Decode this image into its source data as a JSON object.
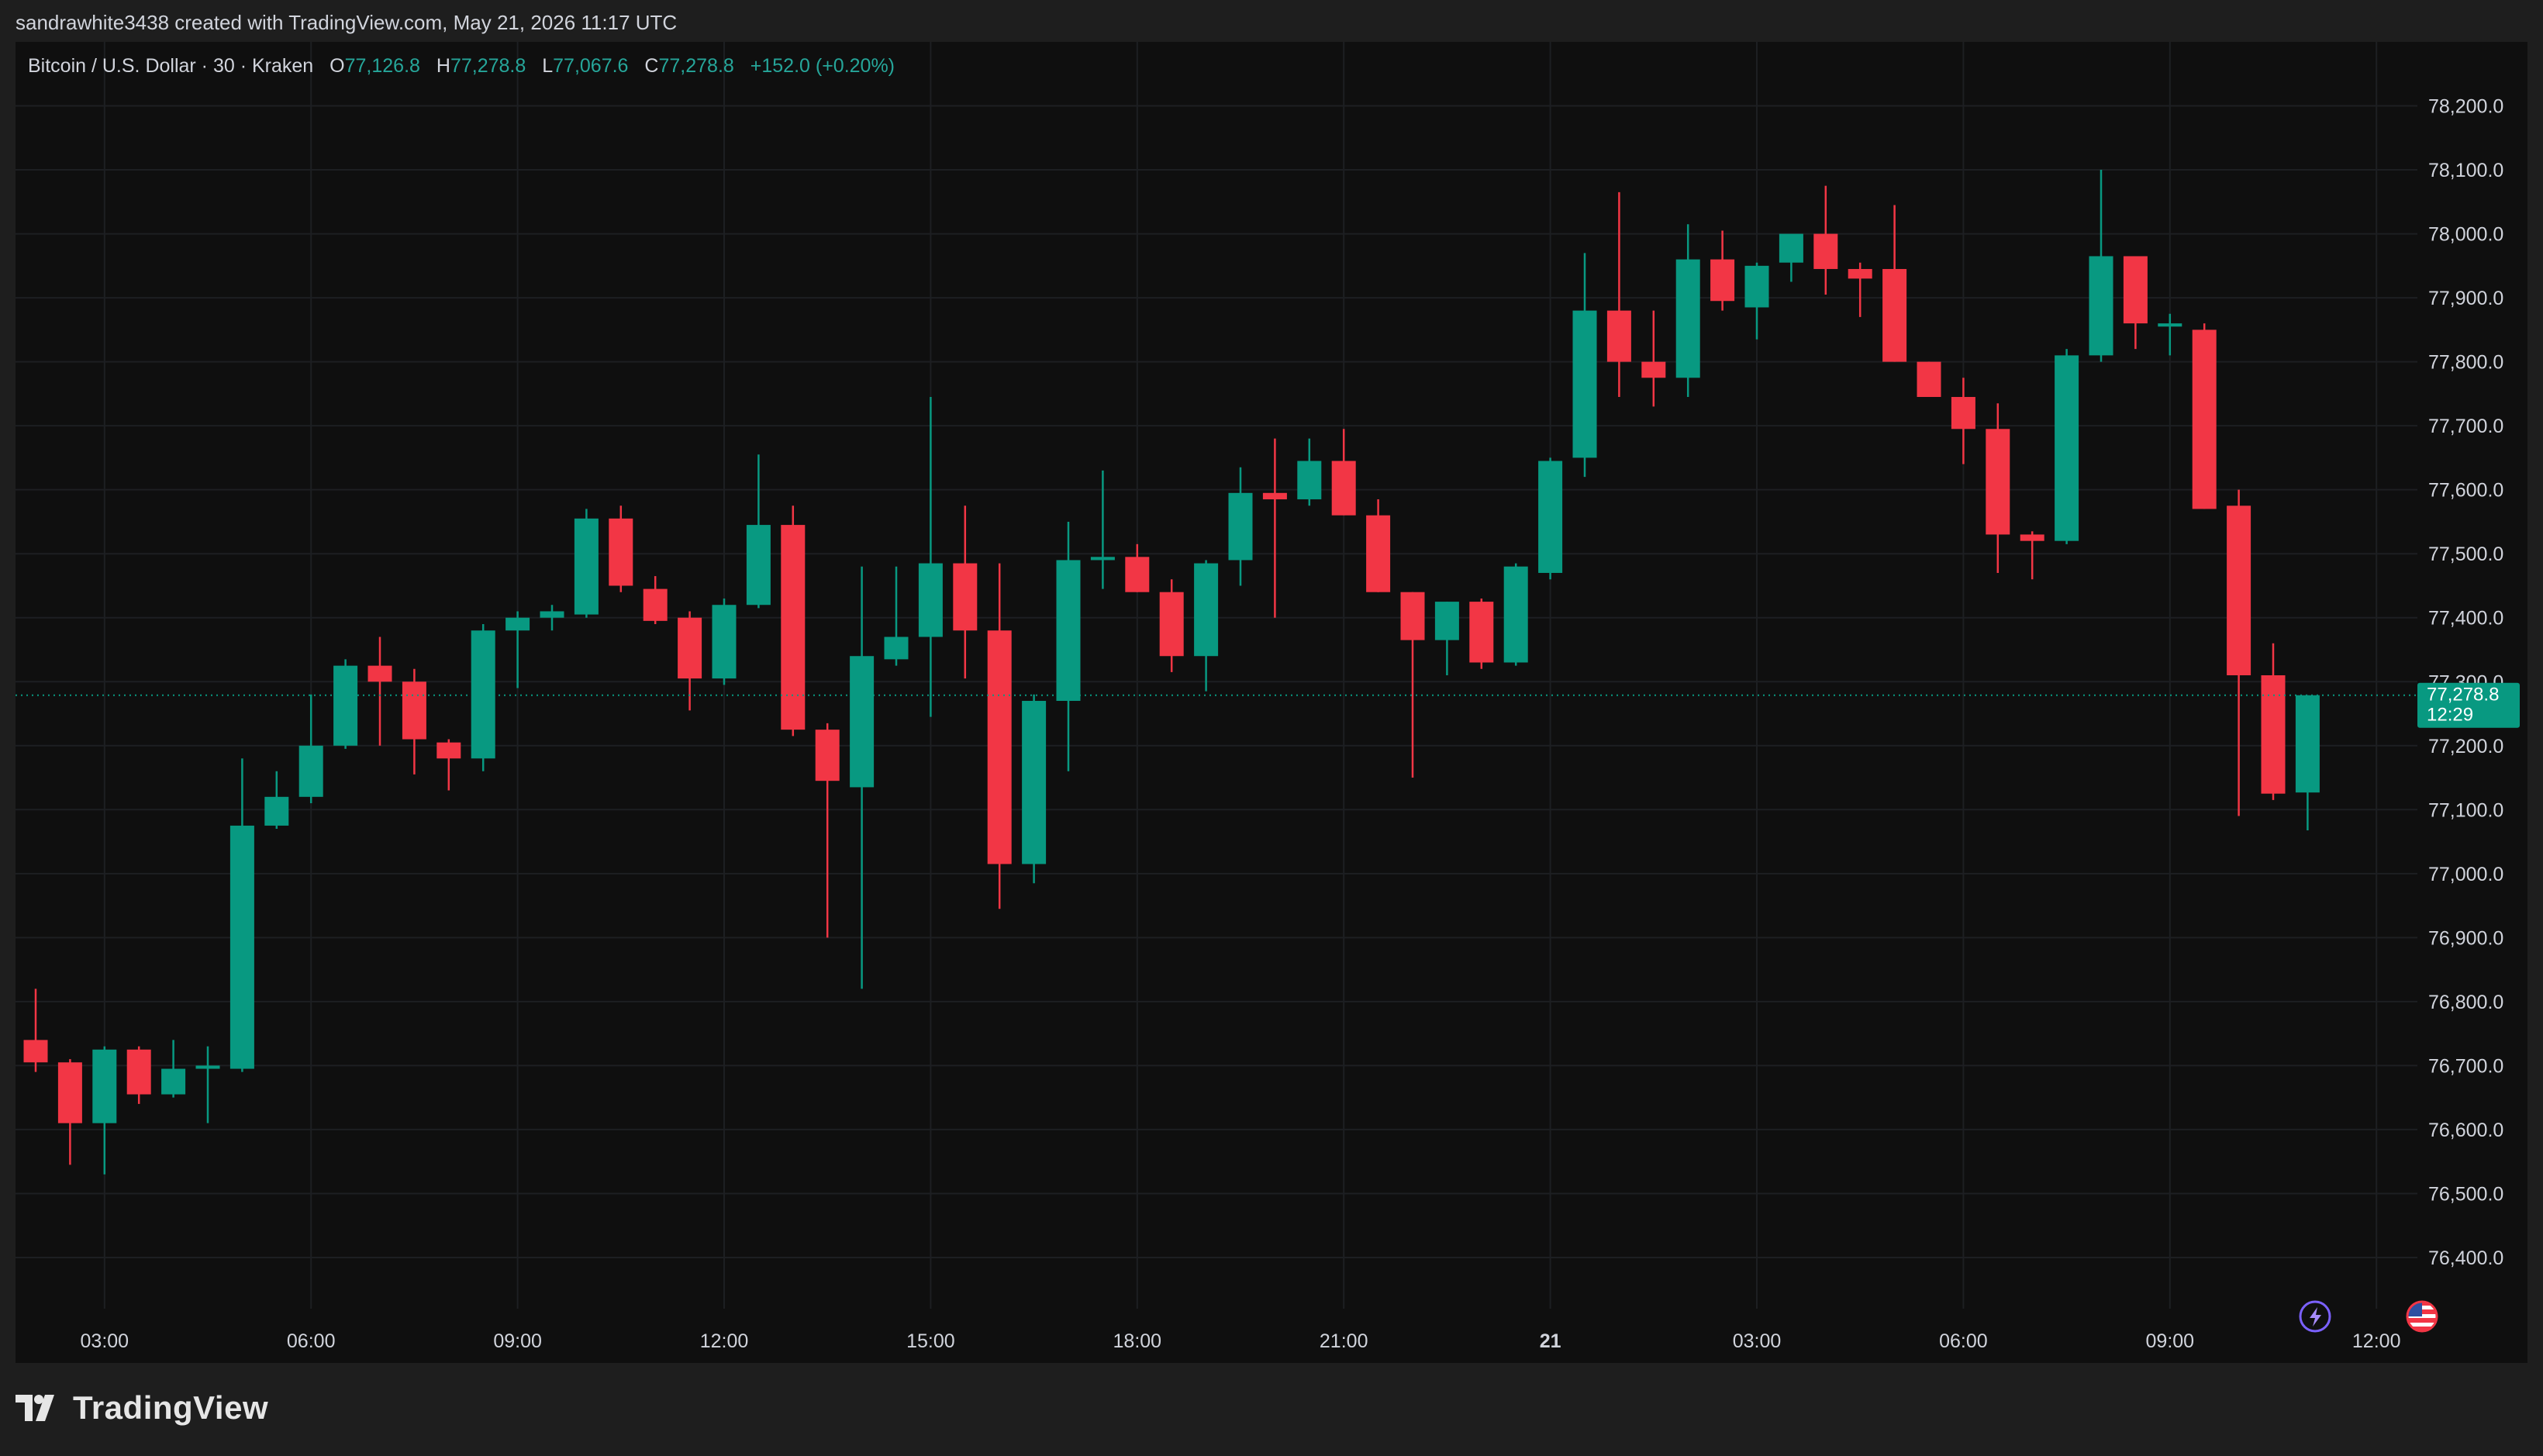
{
  "attribution": "sandrawhite3438 created with TradingView.com, May 21, 2026 11:17 UTC",
  "legend": {
    "symbol": "Bitcoin / U.S. Dollar · 30 · Kraken",
    "o_label": "O",
    "o_value": "77,126.8",
    "h_label": "H",
    "h_value": "77,278.8",
    "l_label": "L",
    "l_value": "77,067.6",
    "c_label": "C",
    "c_value": "77,278.8",
    "change": "+152.0 (+0.20%)"
  },
  "brand": {
    "name": "TradingView"
  },
  "price_badge": {
    "price": "77,278.8",
    "countdown": "12:29"
  },
  "colors": {
    "up": "#089981",
    "down": "#f23645",
    "grid": "#1d1f22",
    "axis_text": "#d1d4dc",
    "background": "#0f0f0f",
    "frame": "#1e1e1e",
    "legend_value": "#26a69a",
    "price_line": "#089981"
  },
  "icons": [
    "tradingview-logo-icon",
    "lightning-icon",
    "us-flag-icon"
  ],
  "chart_data": {
    "type": "candlestick",
    "interval": "30",
    "ylim": [
      76320,
      78300
    ],
    "y_ticks": [
      76400,
      76500,
      76600,
      76700,
      76800,
      76900,
      77000,
      77100,
      77200,
      77300,
      77400,
      77500,
      77600,
      77700,
      77800,
      77900,
      78000,
      78100,
      78200
    ],
    "y_tick_labels": [
      "76,400.0",
      "76,500.0",
      "76,600.0",
      "76,700.0",
      "76,800.0",
      "76,900.0",
      "77,000.0",
      "77,100.0",
      "77,200.0",
      "77,300.0",
      "77,400.0",
      "77,500.0",
      "77,600.0",
      "77,700.0",
      "77,800.0",
      "77,900.0",
      "78,000.0",
      "78,100.0",
      "78,200.0"
    ],
    "x_ticks": [
      "03:00",
      "06:00",
      "09:00",
      "12:00",
      "15:00",
      "18:00",
      "21:00",
      "21",
      "03:00",
      "06:00",
      "09:00",
      "12:00"
    ],
    "x_tick_bold": [
      false,
      false,
      false,
      false,
      false,
      false,
      false,
      true,
      false,
      false,
      false,
      false
    ],
    "x_tick_bars": [
      2,
      8,
      14,
      20,
      26,
      32,
      38,
      44,
      50,
      56,
      62,
      68
    ],
    "last_price": 77278.8,
    "candles": [
      {
        "open": 76740,
        "high": 76820,
        "low": 76690,
        "close": 76705
      },
      {
        "open": 76705,
        "high": 76710,
        "low": 76545,
        "close": 76610
      },
      {
        "open": 76610,
        "high": 76730,
        "low": 76530,
        "close": 76725
      },
      {
        "open": 76725,
        "high": 76730,
        "low": 76640,
        "close": 76655
      },
      {
        "open": 76655,
        "high": 76740,
        "low": 76650,
        "close": 76695
      },
      {
        "open": 76695,
        "high": 76730,
        "low": 76610,
        "close": 76700
      },
      {
        "open": 76695,
        "high": 77180,
        "low": 76690,
        "close": 77075
      },
      {
        "open": 77075,
        "high": 77160,
        "low": 77070,
        "close": 77120
      },
      {
        "open": 77120,
        "high": 77280,
        "low": 77110,
        "close": 77200
      },
      {
        "open": 77200,
        "high": 77335,
        "low": 77195,
        "close": 77325
      },
      {
        "open": 77325,
        "high": 77370,
        "low": 77200,
        "close": 77300
      },
      {
        "open": 77300,
        "high": 77320,
        "low": 77155,
        "close": 77210
      },
      {
        "open": 77205,
        "high": 77210,
        "low": 77130,
        "close": 77180
      },
      {
        "open": 77180,
        "high": 77390,
        "low": 77160,
        "close": 77380
      },
      {
        "open": 77380,
        "high": 77410,
        "low": 77290,
        "close": 77400
      },
      {
        "open": 77400,
        "high": 77420,
        "low": 77380,
        "close": 77410
      },
      {
        "open": 77405,
        "high": 77570,
        "low": 77400,
        "close": 77555
      },
      {
        "open": 77555,
        "high": 77575,
        "low": 77440,
        "close": 77450
      },
      {
        "open": 77445,
        "high": 77465,
        "low": 77390,
        "close": 77395
      },
      {
        "open": 77400,
        "high": 77410,
        "low": 77255,
        "close": 77305
      },
      {
        "open": 77305,
        "high": 77430,
        "low": 77295,
        "close": 77420
      },
      {
        "open": 77420,
        "high": 77655,
        "low": 77415,
        "close": 77545
      },
      {
        "open": 77545,
        "high": 77575,
        "low": 77215,
        "close": 77225
      },
      {
        "open": 77225,
        "high": 77235,
        "low": 76900,
        "close": 77145
      },
      {
        "open": 77135,
        "high": 77480,
        "low": 76820,
        "close": 77340
      },
      {
        "open": 77335,
        "high": 77480,
        "low": 77325,
        "close": 77370
      },
      {
        "open": 77370,
        "high": 77745,
        "low": 77245,
        "close": 77485
      },
      {
        "open": 77485,
        "high": 77575,
        "low": 77305,
        "close": 77380
      },
      {
        "open": 77380,
        "high": 77485,
        "low": 76945,
        "close": 77015
      },
      {
        "open": 77015,
        "high": 77280,
        "low": 76985,
        "close": 77270
      },
      {
        "open": 77270,
        "high": 77550,
        "low": 77160,
        "close": 77490
      },
      {
        "open": 77490,
        "high": 77630,
        "low": 77445,
        "close": 77495
      },
      {
        "open": 77495,
        "high": 77515,
        "low": 77440,
        "close": 77440
      },
      {
        "open": 77440,
        "high": 77460,
        "low": 77315,
        "close": 77340
      },
      {
        "open": 77340,
        "high": 77490,
        "low": 77285,
        "close": 77485
      },
      {
        "open": 77490,
        "high": 77635,
        "low": 77450,
        "close": 77595
      },
      {
        "open": 77595,
        "high": 77680,
        "low": 77400,
        "close": 77585
      },
      {
        "open": 77585,
        "high": 77680,
        "low": 77575,
        "close": 77645
      },
      {
        "open": 77645,
        "high": 77695,
        "low": 77560,
        "close": 77560
      },
      {
        "open": 77560,
        "high": 77585,
        "low": 77440,
        "close": 77440
      },
      {
        "open": 77440,
        "high": 77440,
        "low": 77150,
        "close": 77365
      },
      {
        "open": 77365,
        "high": 77425,
        "low": 77310,
        "close": 77425
      },
      {
        "open": 77425,
        "high": 77430,
        "low": 77320,
        "close": 77330
      },
      {
        "open": 77330,
        "high": 77485,
        "low": 77325,
        "close": 77480
      },
      {
        "open": 77470,
        "high": 77650,
        "low": 77460,
        "close": 77645
      },
      {
        "open": 77650,
        "high": 77970,
        "low": 77620,
        "close": 77880
      },
      {
        "open": 77880,
        "high": 78065,
        "low": 77745,
        "close": 77800
      },
      {
        "open": 77800,
        "high": 77880,
        "low": 77730,
        "close": 77775
      },
      {
        "open": 77775,
        "high": 78015,
        "low": 77745,
        "close": 77960
      },
      {
        "open": 77960,
        "high": 78005,
        "low": 77880,
        "close": 77895
      },
      {
        "open": 77885,
        "high": 77955,
        "low": 77835,
        "close": 77950
      },
      {
        "open": 77955,
        "high": 77995,
        "low": 77925,
        "close": 78000
      },
      {
        "open": 78000,
        "high": 78075,
        "low": 77905,
        "close": 77945
      },
      {
        "open": 77945,
        "high": 77955,
        "low": 77870,
        "close": 77930
      },
      {
        "open": 77945,
        "high": 78045,
        "low": 77800,
        "close": 77800
      },
      {
        "open": 77800,
        "high": 77800,
        "low": 77745,
        "close": 77745
      },
      {
        "open": 77745,
        "high": 77775,
        "low": 77640,
        "close": 77695
      },
      {
        "open": 77695,
        "high": 77735,
        "low": 77470,
        "close": 77530
      },
      {
        "open": 77530,
        "high": 77535,
        "low": 77460,
        "close": 77520
      },
      {
        "open": 77520,
        "high": 77820,
        "low": 77515,
        "close": 77810
      },
      {
        "open": 77810,
        "high": 78100,
        "low": 77800,
        "close": 77965
      },
      {
        "open": 77965,
        "high": 77965,
        "low": 77820,
        "close": 77860
      },
      {
        "open": 77855,
        "high": 77875,
        "low": 77810,
        "close": 77860
      },
      {
        "open": 77850,
        "high": 77860,
        "low": 77570,
        "close": 77570
      },
      {
        "open": 77575,
        "high": 77600,
        "low": 77090,
        "close": 77310
      },
      {
        "open": 77310,
        "high": 77360,
        "low": 77115,
        "close": 77125
      },
      {
        "open": 77126.8,
        "high": 77278.8,
        "low": 77067.6,
        "close": 77278.8
      }
    ]
  }
}
